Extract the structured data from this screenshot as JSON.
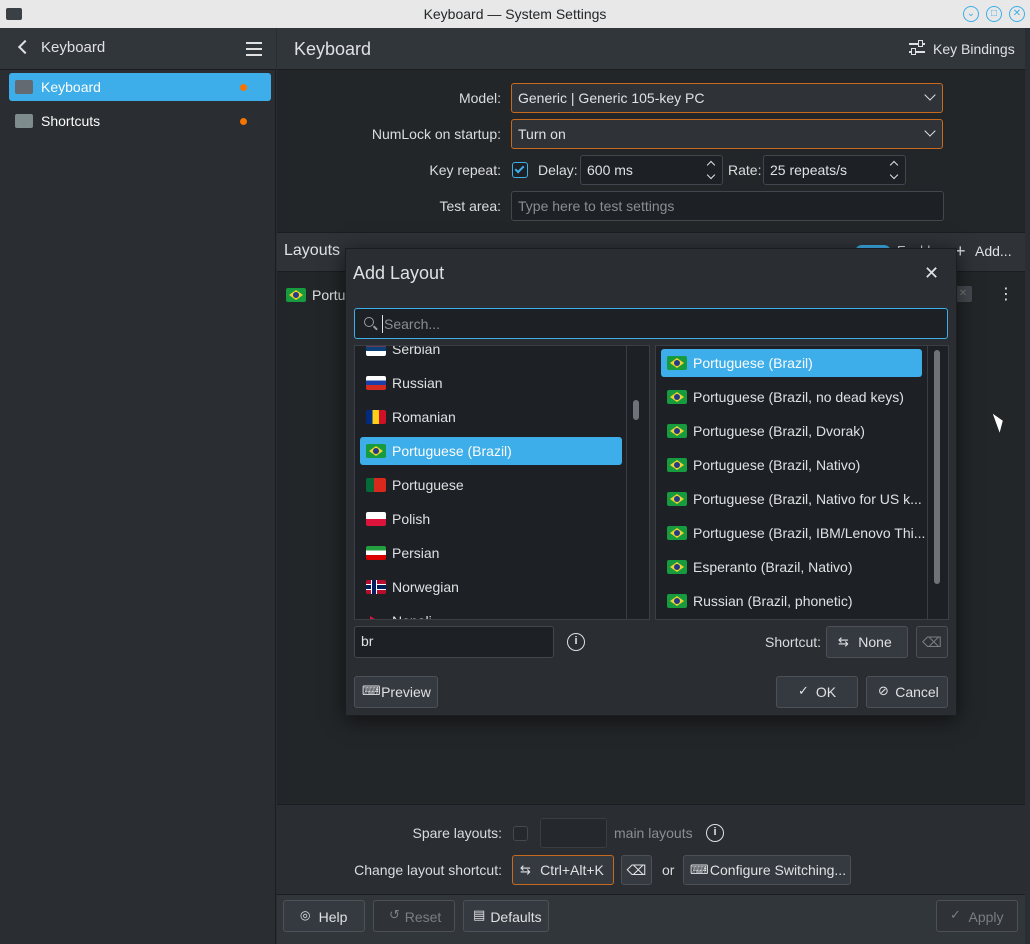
{
  "window": {
    "title": "Keyboard — System Settings"
  },
  "sidebar": {
    "title": "Keyboard",
    "items": [
      {
        "label": "Keyboard",
        "selected": true,
        "modified": true
      },
      {
        "label": "Shortcuts",
        "selected": false,
        "modified": true
      }
    ]
  },
  "main": {
    "title": "Keyboard",
    "key_bindings_label": "Key Bindings",
    "model_label": "Model:",
    "model_value": "Generic | Generic 105-key PC",
    "numlock_label": "NumLock on startup:",
    "numlock_value": "Turn on",
    "key_repeat_label": "Key repeat:",
    "key_repeat_checked": true,
    "delay_label": "Delay:",
    "delay_value": "600 ms",
    "rate_label": "Rate:",
    "rate_value": "25 repeats/s",
    "test_area_label": "Test area:",
    "test_area_placeholder": "Type here to test settings",
    "layouts_title": "Layouts",
    "enable_label": "Enabl",
    "add_label": "Add...",
    "layout_row_partial": "Portu",
    "spare_layouts_label": "Spare layouts:",
    "main_layouts_label": "main layouts",
    "change_shortcut_label": "Change layout shortcut:",
    "shortcut_value": "Ctrl+Alt+K",
    "or_label": "or",
    "configure_switching_label": "Configure Switching..."
  },
  "footer": {
    "help": "Help",
    "reset": "Reset",
    "defaults": "Defaults",
    "apply": "Apply"
  },
  "dialog": {
    "title": "Add Layout",
    "search_placeholder": "Search...",
    "languages": [
      {
        "label": "Serbian",
        "flag": "rs"
      },
      {
        "label": "Russian",
        "flag": "ru"
      },
      {
        "label": "Romanian",
        "flag": "ro"
      },
      {
        "label": "Portuguese (Brazil)",
        "flag": "br",
        "selected": true
      },
      {
        "label": "Portuguese",
        "flag": "pt"
      },
      {
        "label": "Polish",
        "flag": "pl"
      },
      {
        "label": "Persian",
        "flag": "ir"
      },
      {
        "label": "Norwegian",
        "flag": "no"
      },
      {
        "label": "Nepali",
        "flag": "np"
      }
    ],
    "variants": [
      {
        "label": "Portuguese (Brazil)",
        "selected": true
      },
      {
        "label": "Portuguese (Brazil, no dead keys)"
      },
      {
        "label": "Portuguese (Brazil, Dvorak)"
      },
      {
        "label": "Portuguese (Brazil, Nativo)"
      },
      {
        "label": "Portuguese (Brazil, Nativo for US k..."
      },
      {
        "label": "Portuguese (Brazil, IBM/Lenovo Thi..."
      },
      {
        "label": "Esperanto (Brazil, Nativo)"
      },
      {
        "label": "Russian (Brazil, phonetic)"
      }
    ],
    "label_value": "br",
    "shortcut_label": "Shortcut:",
    "shortcut_value": "None",
    "preview_label": "Preview",
    "ok_label": "OK",
    "cancel_label": "Cancel"
  },
  "colors": {
    "accent": "#3daee9",
    "modified_dot": "#f67400",
    "focus_border": "#c76a1d"
  }
}
